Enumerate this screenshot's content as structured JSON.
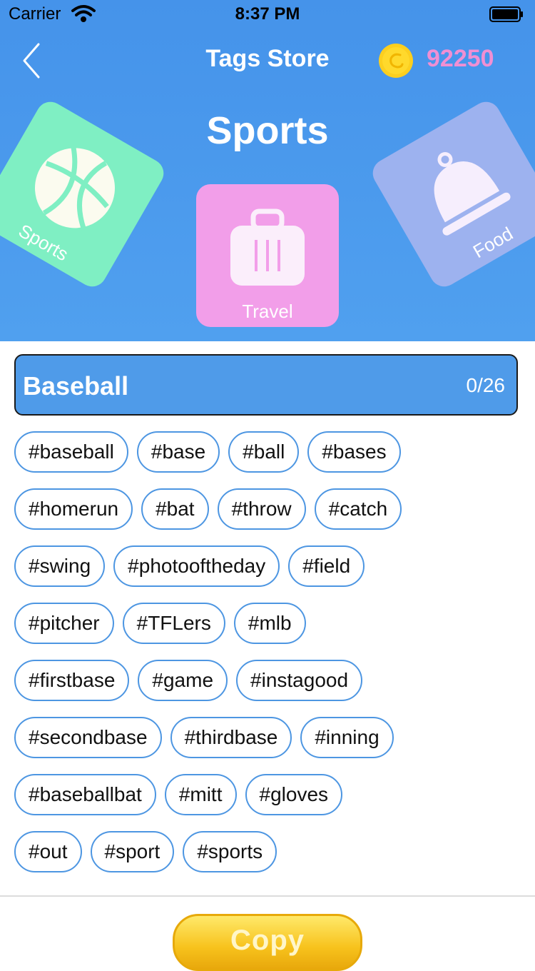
{
  "status_bar": {
    "carrier": "Carrier",
    "time": "8:37 PM"
  },
  "nav": {
    "title": "Tags Store",
    "coins": "92250"
  },
  "category": {
    "title": "Sports",
    "cards": [
      {
        "label": "Sports",
        "icon": "basketball-icon",
        "color": "#7fefc3"
      },
      {
        "label": "Travel",
        "icon": "suitcase-icon",
        "color": "#f29ee9"
      },
      {
        "label": "Food",
        "icon": "food-cloche-icon",
        "color": "#9db2ef"
      }
    ]
  },
  "section": {
    "title": "Baseball",
    "count": "0/26"
  },
  "tags": [
    [
      "#baseball",
      "#base",
      "#ball",
      "#bases"
    ],
    [
      "#homerun",
      "#bat",
      "#throw",
      "#catch"
    ],
    [
      "#swing",
      "#photooftheday",
      "#field"
    ],
    [
      "#pitcher",
      "#TFLers",
      "#mlb"
    ],
    [
      "#firstbase",
      "#game",
      "#instagood"
    ],
    [
      "#secondbase",
      "#thirdbase",
      "#inning"
    ],
    [
      "#baseballbat",
      "#mitt",
      "#gloves"
    ],
    [
      "#out",
      "#sport",
      "#sports"
    ]
  ],
  "copy_button": {
    "label": "Copy"
  },
  "colors": {
    "header": "#4593ea",
    "accent": "#4f9be9",
    "coin_text": "#f08fd3",
    "tag_border": "#4d96e2"
  }
}
